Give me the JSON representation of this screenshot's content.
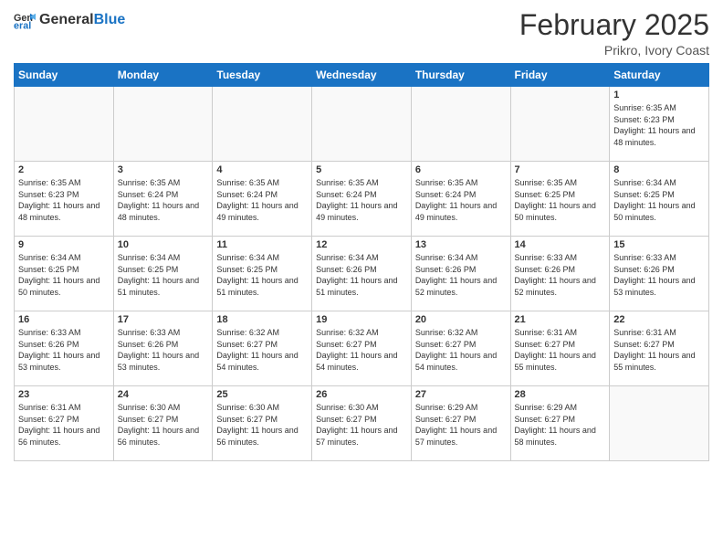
{
  "header": {
    "logo_general": "General",
    "logo_blue": "Blue",
    "month_title": "February 2025",
    "location": "Prikro, Ivory Coast"
  },
  "weekdays": [
    "Sunday",
    "Monday",
    "Tuesday",
    "Wednesday",
    "Thursday",
    "Friday",
    "Saturday"
  ],
  "weeks": [
    [
      {
        "day": "",
        "info": ""
      },
      {
        "day": "",
        "info": ""
      },
      {
        "day": "",
        "info": ""
      },
      {
        "day": "",
        "info": ""
      },
      {
        "day": "",
        "info": ""
      },
      {
        "day": "",
        "info": ""
      },
      {
        "day": "1",
        "info": "Sunrise: 6:35 AM\nSunset: 6:23 PM\nDaylight: 11 hours\nand 48 minutes."
      }
    ],
    [
      {
        "day": "2",
        "info": "Sunrise: 6:35 AM\nSunset: 6:23 PM\nDaylight: 11 hours\nand 48 minutes."
      },
      {
        "day": "3",
        "info": "Sunrise: 6:35 AM\nSunset: 6:24 PM\nDaylight: 11 hours\nand 48 minutes."
      },
      {
        "day": "4",
        "info": "Sunrise: 6:35 AM\nSunset: 6:24 PM\nDaylight: 11 hours\nand 49 minutes."
      },
      {
        "day": "5",
        "info": "Sunrise: 6:35 AM\nSunset: 6:24 PM\nDaylight: 11 hours\nand 49 minutes."
      },
      {
        "day": "6",
        "info": "Sunrise: 6:35 AM\nSunset: 6:24 PM\nDaylight: 11 hours\nand 49 minutes."
      },
      {
        "day": "7",
        "info": "Sunrise: 6:35 AM\nSunset: 6:25 PM\nDaylight: 11 hours\nand 50 minutes."
      },
      {
        "day": "8",
        "info": "Sunrise: 6:34 AM\nSunset: 6:25 PM\nDaylight: 11 hours\nand 50 minutes."
      }
    ],
    [
      {
        "day": "9",
        "info": "Sunrise: 6:34 AM\nSunset: 6:25 PM\nDaylight: 11 hours\nand 50 minutes."
      },
      {
        "day": "10",
        "info": "Sunrise: 6:34 AM\nSunset: 6:25 PM\nDaylight: 11 hours\nand 51 minutes."
      },
      {
        "day": "11",
        "info": "Sunrise: 6:34 AM\nSunset: 6:25 PM\nDaylight: 11 hours\nand 51 minutes."
      },
      {
        "day": "12",
        "info": "Sunrise: 6:34 AM\nSunset: 6:26 PM\nDaylight: 11 hours\nand 51 minutes."
      },
      {
        "day": "13",
        "info": "Sunrise: 6:34 AM\nSunset: 6:26 PM\nDaylight: 11 hours\nand 52 minutes."
      },
      {
        "day": "14",
        "info": "Sunrise: 6:33 AM\nSunset: 6:26 PM\nDaylight: 11 hours\nand 52 minutes."
      },
      {
        "day": "15",
        "info": "Sunrise: 6:33 AM\nSunset: 6:26 PM\nDaylight: 11 hours\nand 53 minutes."
      }
    ],
    [
      {
        "day": "16",
        "info": "Sunrise: 6:33 AM\nSunset: 6:26 PM\nDaylight: 11 hours\nand 53 minutes."
      },
      {
        "day": "17",
        "info": "Sunrise: 6:33 AM\nSunset: 6:26 PM\nDaylight: 11 hours\nand 53 minutes."
      },
      {
        "day": "18",
        "info": "Sunrise: 6:32 AM\nSunset: 6:27 PM\nDaylight: 11 hours\nand 54 minutes."
      },
      {
        "day": "19",
        "info": "Sunrise: 6:32 AM\nSunset: 6:27 PM\nDaylight: 11 hours\nand 54 minutes."
      },
      {
        "day": "20",
        "info": "Sunrise: 6:32 AM\nSunset: 6:27 PM\nDaylight: 11 hours\nand 54 minutes."
      },
      {
        "day": "21",
        "info": "Sunrise: 6:31 AM\nSunset: 6:27 PM\nDaylight: 11 hours\nand 55 minutes."
      },
      {
        "day": "22",
        "info": "Sunrise: 6:31 AM\nSunset: 6:27 PM\nDaylight: 11 hours\nand 55 minutes."
      }
    ],
    [
      {
        "day": "23",
        "info": "Sunrise: 6:31 AM\nSunset: 6:27 PM\nDaylight: 11 hours\nand 56 minutes."
      },
      {
        "day": "24",
        "info": "Sunrise: 6:30 AM\nSunset: 6:27 PM\nDaylight: 11 hours\nand 56 minutes."
      },
      {
        "day": "25",
        "info": "Sunrise: 6:30 AM\nSunset: 6:27 PM\nDaylight: 11 hours\nand 56 minutes."
      },
      {
        "day": "26",
        "info": "Sunrise: 6:30 AM\nSunset: 6:27 PM\nDaylight: 11 hours\nand 57 minutes."
      },
      {
        "day": "27",
        "info": "Sunrise: 6:29 AM\nSunset: 6:27 PM\nDaylight: 11 hours\nand 57 minutes."
      },
      {
        "day": "28",
        "info": "Sunrise: 6:29 AM\nSunset: 6:27 PM\nDaylight: 11 hours\nand 58 minutes."
      },
      {
        "day": "",
        "info": ""
      }
    ]
  ]
}
